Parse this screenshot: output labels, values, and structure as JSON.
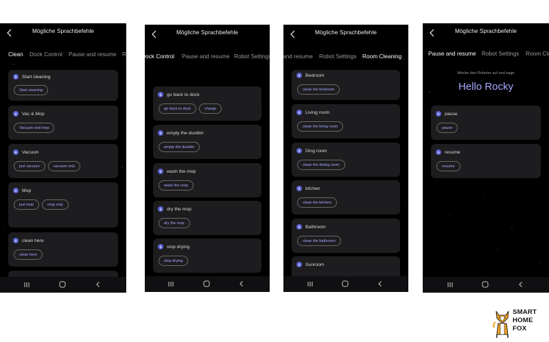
{
  "screens": [
    {
      "title": "Mögliche Sprachbefehle",
      "tabs": [
        "Clean",
        "Dock Control",
        "Pause and resume",
        "Ro"
      ],
      "active_tab": "Clean",
      "cards": [
        {
          "title": "Start cleaning",
          "chips": [
            "Start cleaning"
          ]
        },
        {
          "title": "Vac & Mop",
          "chips": [
            "Vacuum and mop"
          ]
        },
        {
          "title": "Vacuum",
          "chips": [
            "just vacuum",
            "vacuum only"
          ]
        },
        {
          "title": "Mop",
          "chips": [
            "just mop",
            "mop only"
          ]
        },
        {
          "title": "clean here",
          "chips": [
            "clean here"
          ]
        }
      ]
    },
    {
      "title": "Mögliche Sprachbefehle",
      "tabs": [
        "Dock Control",
        "Pause and resume",
        "Robot Settings"
      ],
      "active_tab": "Dock Control",
      "cards": [
        {
          "title": "go back to dock",
          "chips": [
            "go back to dock",
            "charge"
          ]
        },
        {
          "title": "empty the dustbin",
          "chips": [
            "empty the dustbin"
          ]
        },
        {
          "title": "wash the mop",
          "chips": [
            "wash the mop"
          ]
        },
        {
          "title": "dry the mop",
          "chips": [
            "dry the mop"
          ]
        },
        {
          "title": "stop drying",
          "chips": [
            "stop drying"
          ]
        }
      ]
    },
    {
      "title": "Mögliche Sprachbefehle",
      "tabs": [
        "and resume",
        "Robot Settings",
        "Room Cleaning"
      ],
      "active_tab": "Room Cleaning",
      "cards": [
        {
          "title": "Bedroom",
          "chips": [
            "clean the bedroom"
          ]
        },
        {
          "title": "Living room",
          "chips": [
            "clean the living room"
          ]
        },
        {
          "title": "Ding room",
          "chips": [
            "clean the dining room"
          ]
        },
        {
          "title": "kitchen",
          "chips": [
            "clean the kitchen"
          ]
        },
        {
          "title": "Bathroom",
          "chips": [
            "clean the bathroom"
          ]
        },
        {
          "title": "Sunroom",
          "chips": []
        }
      ]
    },
    {
      "title": "Mögliche Sprachbefehle",
      "tabs": [
        "Pause and resume",
        "Robot Settings",
        "Room Cle"
      ],
      "active_tab": "Pause and resume",
      "wake_hint": "Wecke den Roboter auf und sage",
      "wake_phrase": "Hello Rocky",
      "cards": [
        {
          "title": "pause",
          "chips": [
            "pause"
          ]
        },
        {
          "title": "resume",
          "chips": [
            "resume"
          ]
        }
      ]
    }
  ],
  "brand": {
    "line1": "SMART",
    "line2": "HOME",
    "line3": "FOX"
  },
  "colors": {
    "accent": "#5b63d8",
    "chip_text": "#a6a8ff",
    "card_bg": "#1d1d1f",
    "wake_phrase": "#a8a8ff"
  },
  "icons": [
    "back-arrow-icon",
    "microphone-icon",
    "recent-apps-icon",
    "home-icon",
    "nav-back-icon",
    "fox-logo-icon"
  ]
}
